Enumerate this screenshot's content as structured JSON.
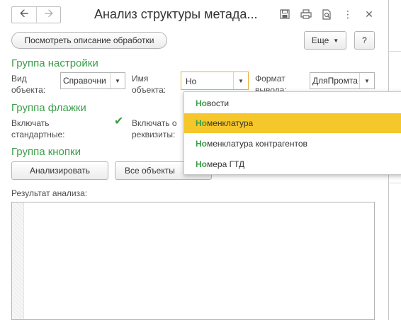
{
  "window": {
    "title": "Анализ структуры метада...",
    "nav_back_icon": "arrow-left-icon",
    "nav_forward_icon": "arrow-right-icon",
    "toolbar_icons": [
      "save-icon",
      "print-icon",
      "preview-icon",
      "more-vertical-icon",
      "close-icon"
    ]
  },
  "toolbar": {
    "description_button": "Посмотреть описание обработки",
    "more_button": "Еще",
    "help_button": "?"
  },
  "settings_group": {
    "title": "Группа настройки",
    "object_type_label": [
      "Вид",
      "объекта:"
    ],
    "object_type_value": "Справочни",
    "object_name_label": [
      "Имя",
      "объекта:"
    ],
    "object_name_value": "Но",
    "output_format_label": [
      "Формат",
      "вывода:"
    ],
    "output_format_value": "ДляПромта"
  },
  "flags_group": {
    "title": "Группа флажки",
    "include_standard_label": [
      "Включать",
      "стандартные:"
    ],
    "include_standard_checked": true,
    "include_other_label": [
      "Включать о",
      "реквизиты:"
    ]
  },
  "buttons_group": {
    "title": "Группа кнопки",
    "analyze_button": "Анализировать",
    "all_objects_button": "Все объекты"
  },
  "result": {
    "label": "Результат анализа:"
  },
  "dropdown": {
    "highlight": "Но",
    "items": [
      {
        "prefix": "Но",
        "rest": "вости",
        "selected": false
      },
      {
        "prefix": "Но",
        "rest": "менклатура",
        "selected": true
      },
      {
        "prefix": "Но",
        "rest": "менклатура контрагентов",
        "selected": false
      },
      {
        "prefix": "Но",
        "rest": "мера ГТД",
        "selected": false
      }
    ]
  },
  "colors": {
    "group_title": "#3c9d49",
    "selected_item": "#f5c72a",
    "active_border": "#e8b23a"
  }
}
